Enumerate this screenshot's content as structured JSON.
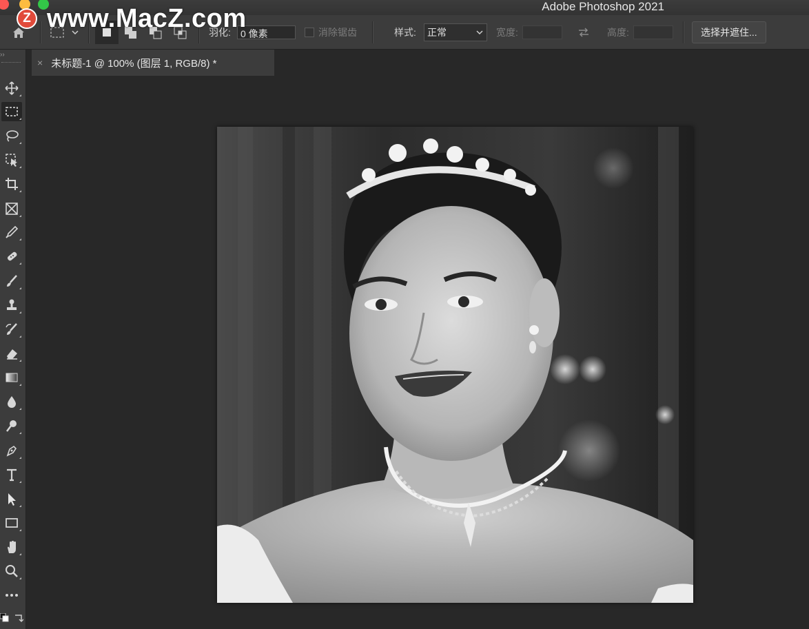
{
  "window": {
    "app_title": "Adobe Photoshop 2021"
  },
  "watermark": {
    "logo_letter": "Z",
    "text": "www.MacZ.com"
  },
  "options_bar": {
    "feather_label": "羽化:",
    "feather_value": "0 像素",
    "antialias_label": "消除锯齿",
    "style_label": "样式:",
    "style_value": "正常",
    "width_label": "宽度:",
    "height_label": "高度:",
    "select_mask_button": "选择并遮住..."
  },
  "document_tab": {
    "title": "未标题-1 @ 100% (图层 1, RGB/8) *",
    "close_glyph": "×"
  },
  "tools": [
    {
      "name": "move-tool-icon"
    },
    {
      "name": "rectangular-marquee-tool-icon",
      "active": true
    },
    {
      "name": "lasso-tool-icon"
    },
    {
      "name": "object-selection-tool-icon"
    },
    {
      "name": "crop-tool-icon"
    },
    {
      "name": "frame-tool-icon"
    },
    {
      "name": "eyedropper-tool-icon"
    },
    {
      "name": "healing-brush-tool-icon"
    },
    {
      "name": "brush-tool-icon"
    },
    {
      "name": "clone-stamp-tool-icon"
    },
    {
      "name": "history-brush-tool-icon"
    },
    {
      "name": "eraser-tool-icon"
    },
    {
      "name": "gradient-tool-icon"
    },
    {
      "name": "blur-tool-icon"
    },
    {
      "name": "dodge-tool-icon"
    },
    {
      "name": "pen-tool-icon"
    },
    {
      "name": "type-tool-icon"
    },
    {
      "name": "path-selection-tool-icon"
    },
    {
      "name": "rectangle-tool-icon"
    },
    {
      "name": "hand-tool-icon"
    },
    {
      "name": "zoom-tool-icon"
    },
    {
      "name": "more-tools-icon"
    }
  ],
  "canvas": {
    "image_description_name": "portrait-photo"
  },
  "colors": {
    "ui_panel": "#3c3c3c",
    "workspace": "#282828",
    "watermark_red": "#e14a3a"
  }
}
